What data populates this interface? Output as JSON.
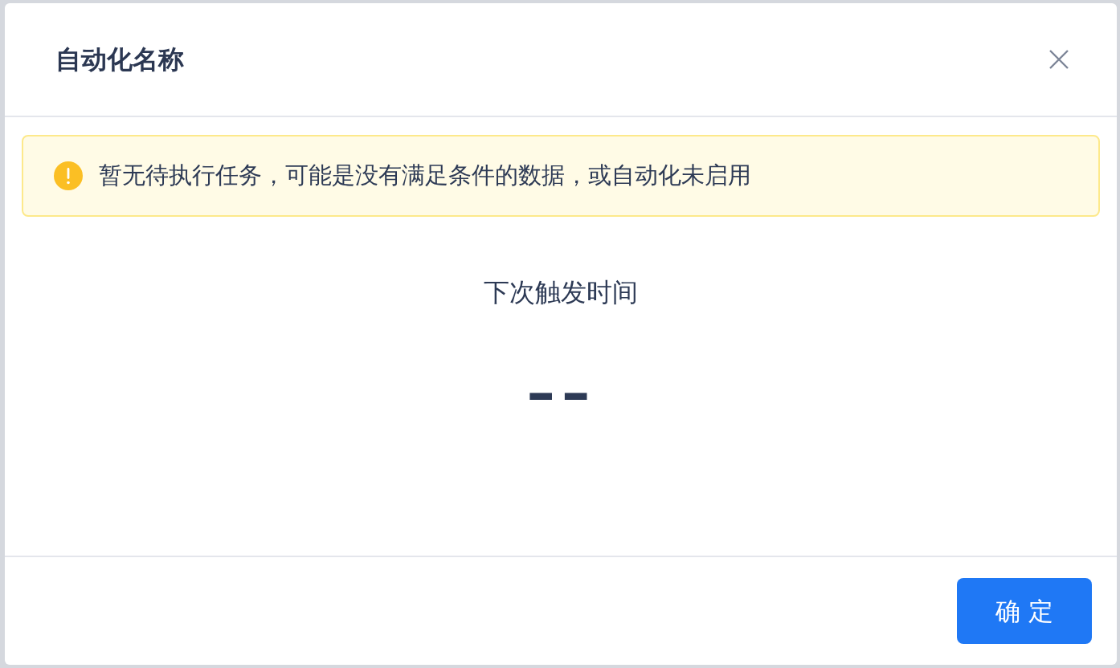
{
  "dialog": {
    "title": "自动化名称",
    "alert": {
      "message": "暂无待执行任务，可能是没有满足条件的数据，或自动化未启用"
    },
    "next_trigger": {
      "label": "下次触发时间",
      "value": "--"
    },
    "buttons": [
      "确 定"
    ]
  }
}
